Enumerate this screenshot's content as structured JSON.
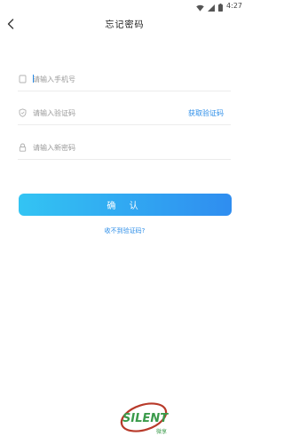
{
  "status_bar": {
    "time": "4:27",
    "icons": [
      "wifi-icon",
      "cellular-signal-icon",
      "battery-icon"
    ]
  },
  "nav": {
    "back_icon": "chevron-left-icon",
    "title": "忘记密码"
  },
  "form": {
    "phone": {
      "icon": "phone-icon",
      "placeholder": "请输入手机号",
      "value": ""
    },
    "code": {
      "icon": "shield-icon",
      "placeholder": "请输入验证码",
      "value": "",
      "get_code_label": "获取验证码"
    },
    "new_password": {
      "icon": "lock-icon",
      "placeholder": "请输入新密码",
      "value": ""
    }
  },
  "confirm_label": "确 认",
  "no_code_label": "收不到验证码?",
  "watermark": {
    "text": "SILENT",
    "sub_text": "微享"
  },
  "colors": {
    "accent": "#2b8de8",
    "button_gradient_start": "#33c4f3",
    "button_gradient_end": "#2f8df0",
    "placeholder": "#9a9a9a",
    "divider": "#ececec",
    "watermark_green": "#3a9a4a",
    "watermark_red": "#b83a2a"
  }
}
